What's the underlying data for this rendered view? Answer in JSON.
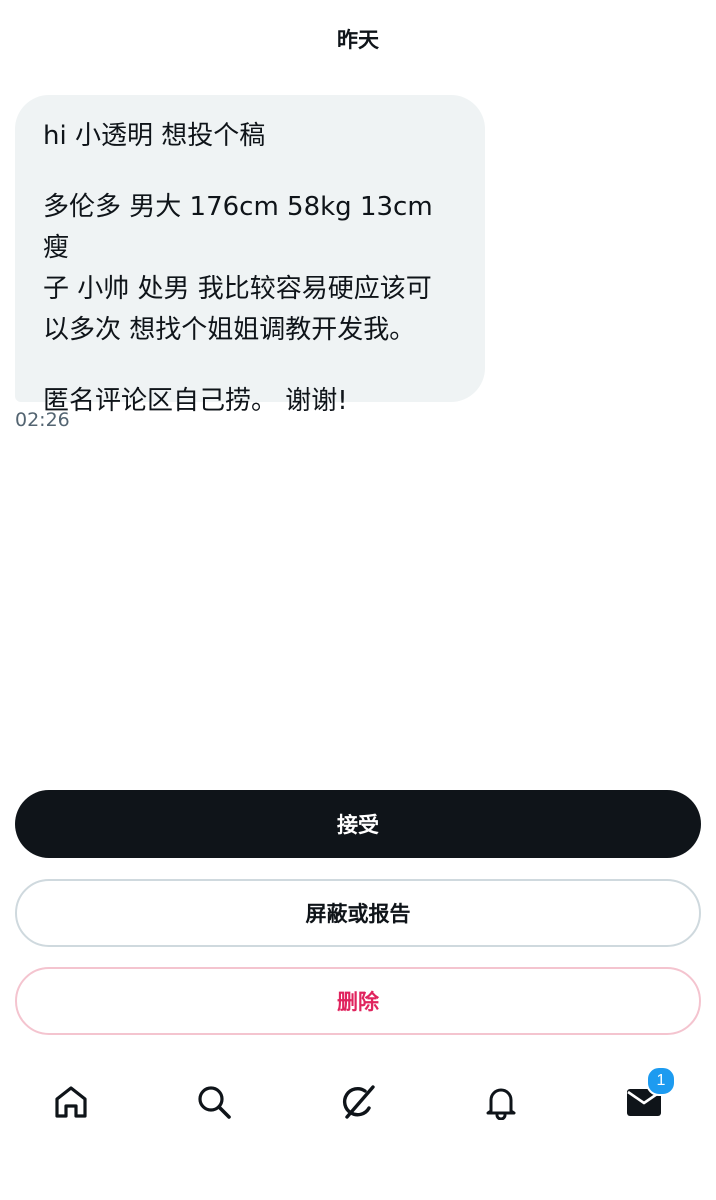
{
  "header": {
    "date_label": "昨天"
  },
  "message": {
    "line1": "hi 小透明 想投个稿",
    "paragraph2": "多伦多 男大 176cm 58kg 13cm 瘦\n子 小帅 处男 我比较容易硬应该可\n以多次  想找个姐姐调教开发我。",
    "line3": "匿名评论区自己捞。 谢谢!",
    "time": "02:26"
  },
  "actions": {
    "accept_label": "接受",
    "block_report_label": "屏蔽或报告",
    "delete_label": "删除"
  },
  "tabbar": {
    "items": [
      {
        "icon": "home-icon"
      },
      {
        "icon": "search-icon"
      },
      {
        "icon": "grok-icon"
      },
      {
        "icon": "bell-icon"
      },
      {
        "icon": "mail-icon",
        "badge": "1"
      }
    ]
  },
  "colors": {
    "accept_bg": "#0f1419",
    "delete_text": "#e0245e",
    "bubble_bg": "#eff3f4",
    "badge_bg": "#1d9bf0"
  }
}
